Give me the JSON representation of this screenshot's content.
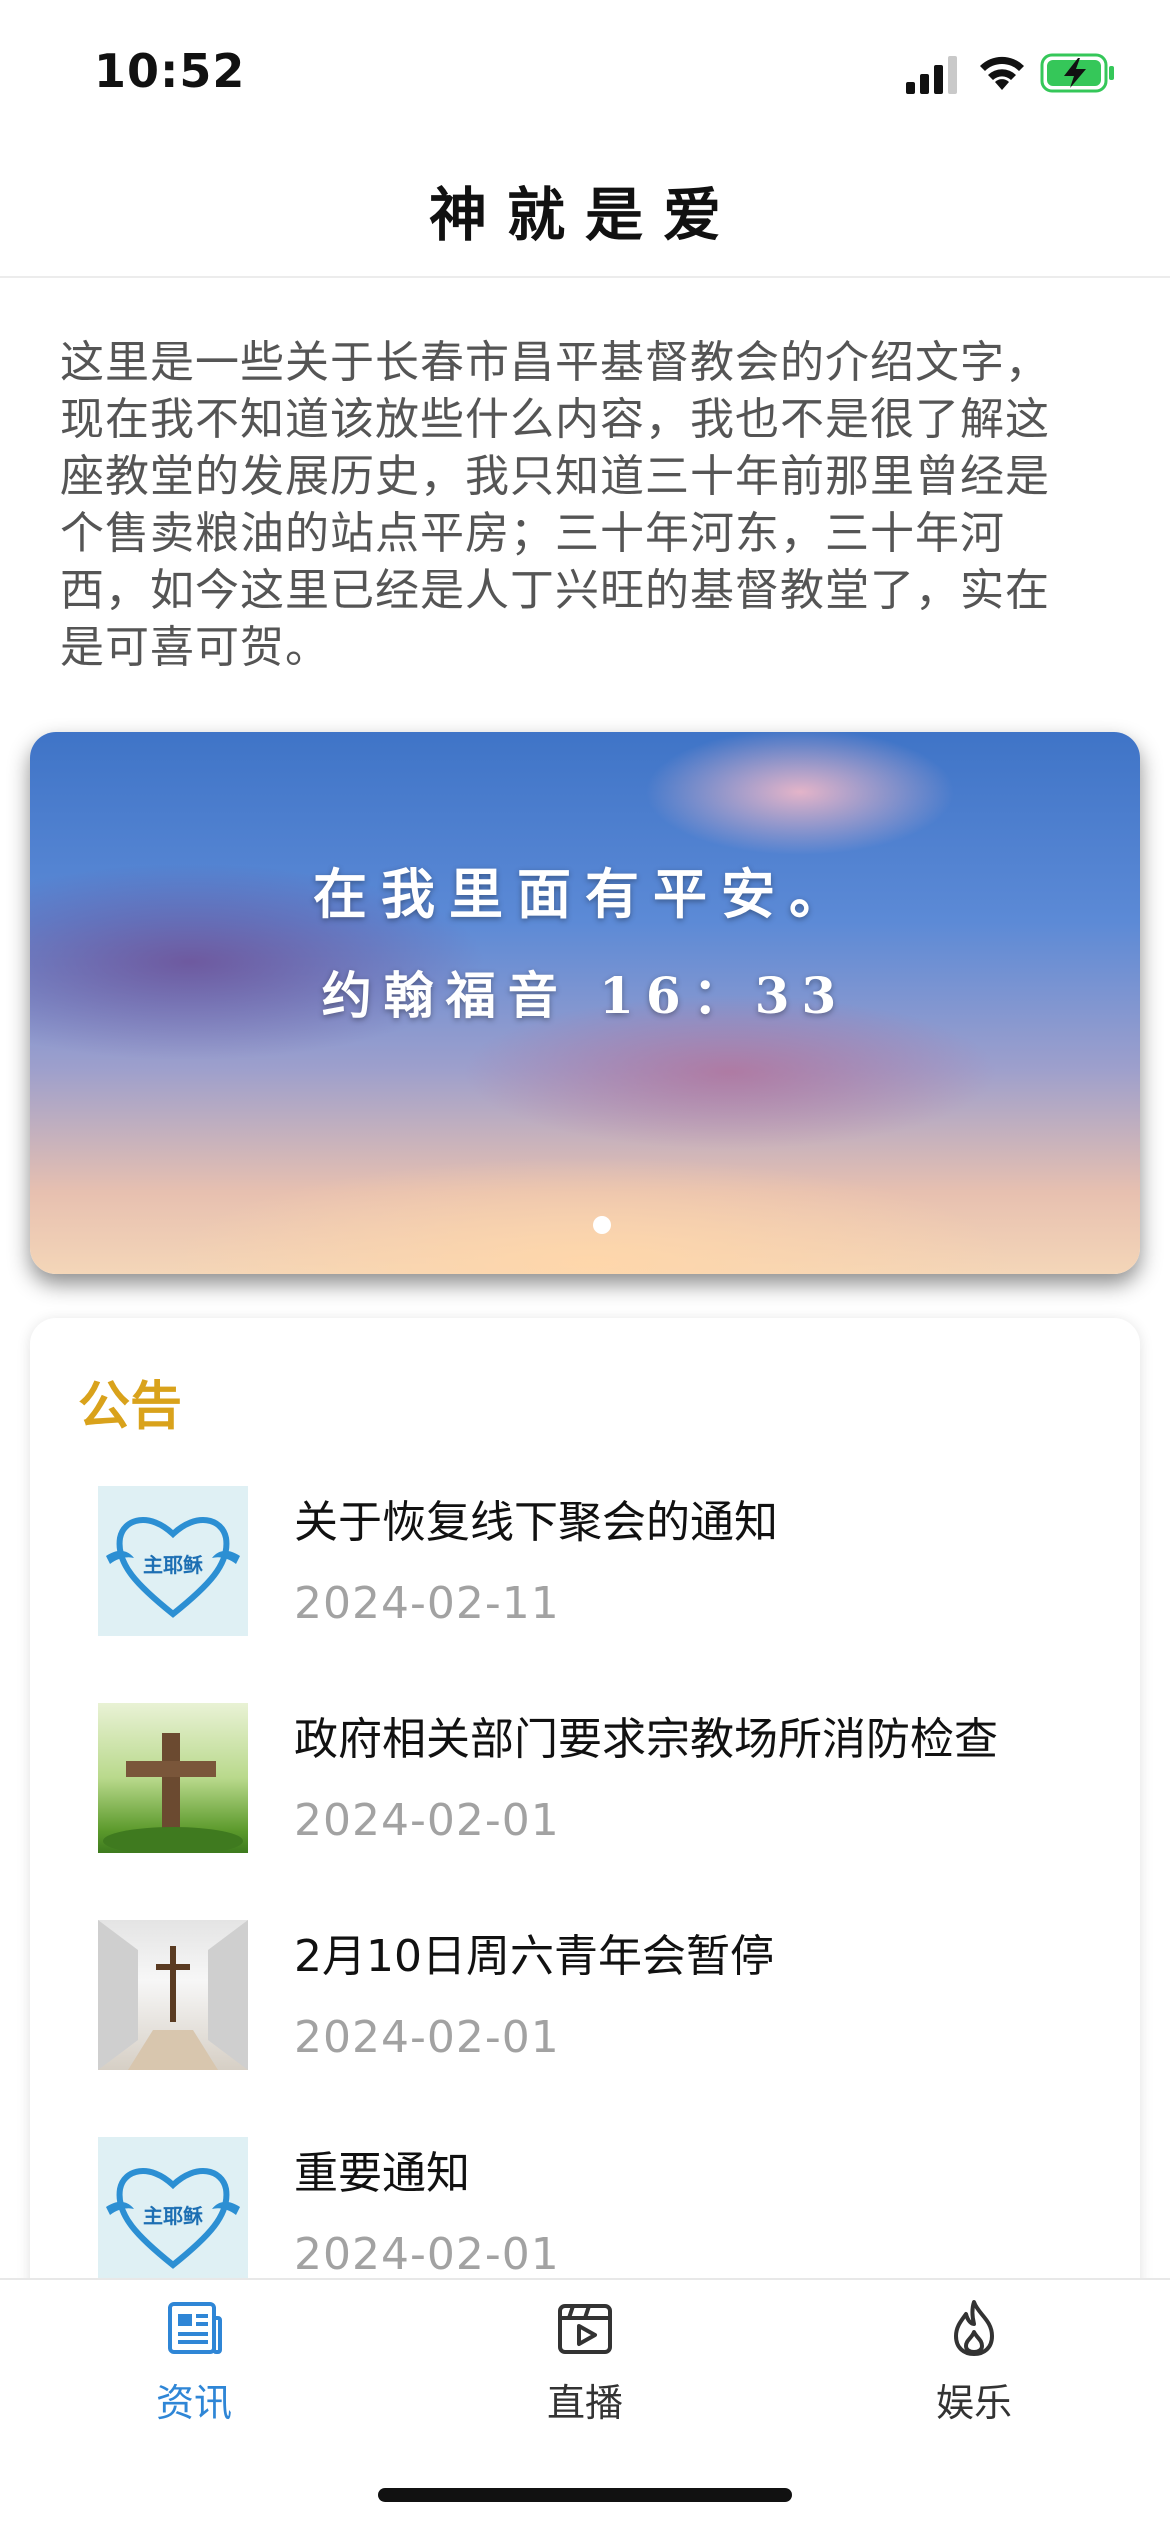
{
  "status_bar": {
    "time": "10:52",
    "icons": [
      "cellular-signal-icon",
      "wifi-icon",
      "battery-charging-icon"
    ],
    "battery_color": "#35c759"
  },
  "header": {
    "title": "神就是爱"
  },
  "intro": {
    "text": "这里是一些关于长春市昌平基督教会的介绍文字，现在我不知道该放些什么内容，我也不是很了解这座教堂的发展历史，我只知道三十年前那里曾经是个售卖粮油的站点平房；三十年河东，三十年河西，如今这里已经是人丁兴旺的基督教堂了，实在是可喜可贺。"
  },
  "banner": {
    "line1": "在我里面有平安。",
    "line2": "约翰福音 16：33",
    "carousel_dots": 1
  },
  "notices": {
    "title": "公告",
    "accent_color": "#d9a21b",
    "items": [
      {
        "title": "关于恢复线下聚会的通知",
        "date": "2024-02-11",
        "thumb_icon": "heart-wings-logo-icon",
        "thumb_text": "主耶稣"
      },
      {
        "title": "政府相关部门要求宗教场所消防检查",
        "date": "2024-02-01",
        "thumb_icon": "cross-on-grass-icon"
      },
      {
        "title": "2月10日周六青年会暂停",
        "date": "2024-02-01",
        "thumb_icon": "cross-in-hall-icon"
      },
      {
        "title": "重要通知",
        "date": "2024-02-01",
        "thumb_icon": "heart-wings-logo-icon",
        "thumb_text": "主耶稣"
      }
    ]
  },
  "tab_bar": {
    "active_color": "#2f86d6",
    "tabs": [
      {
        "label": "资讯",
        "icon": "news-icon",
        "active": true
      },
      {
        "label": "直播",
        "icon": "video-play-icon",
        "active": false
      },
      {
        "label": "娱乐",
        "icon": "flame-icon",
        "active": false
      }
    ]
  }
}
